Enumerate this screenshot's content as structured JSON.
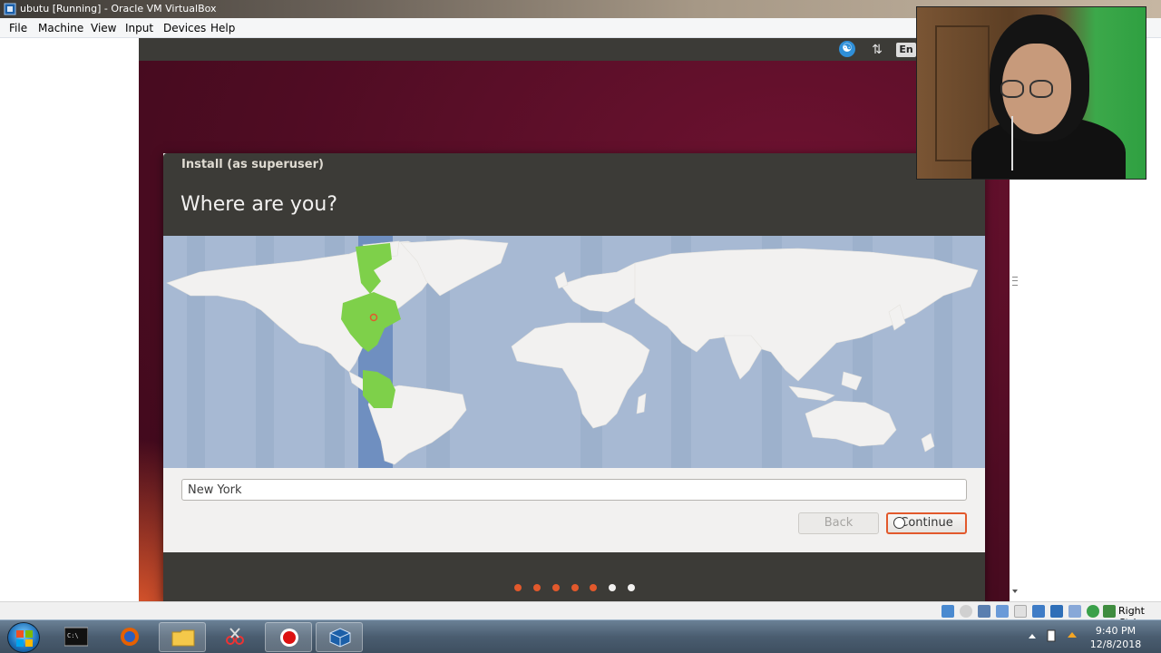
{
  "window": {
    "title": "ubutu [Running] - Oracle VM VirtualBox"
  },
  "menubar": {
    "items": [
      "File",
      "Machine",
      "View",
      "Input",
      "Devices",
      "Help"
    ]
  },
  "guest_topbar": {
    "language": "En",
    "icons": [
      "accessibility-icon",
      "network-icon",
      "keyboard-language-indicator"
    ]
  },
  "installer": {
    "window_title": "Install (as superuser)",
    "heading": "Where are you?",
    "location_value": "New York",
    "back_label": "Back",
    "continue_label": "Continue",
    "progress": {
      "completed_steps": 5,
      "total_steps": 7
    },
    "selected_timezone_marker": "America/New_York"
  },
  "statusbar": {
    "host_key": "Right Ctrl"
  },
  "taskbar": {
    "apps": [
      "start-button",
      "command-prompt",
      "firefox",
      "file-explorer",
      "snipping-tool",
      "screen-recorder",
      "virtualbox"
    ],
    "time": "9:40 PM",
    "date": "12/8/2018"
  },
  "colors": {
    "ubuntu_orange": "#e2592c",
    "panel_dark": "#3c3b37",
    "map_ocean": "#a7b9d3",
    "timezone_highlight": "#7ed04a"
  }
}
